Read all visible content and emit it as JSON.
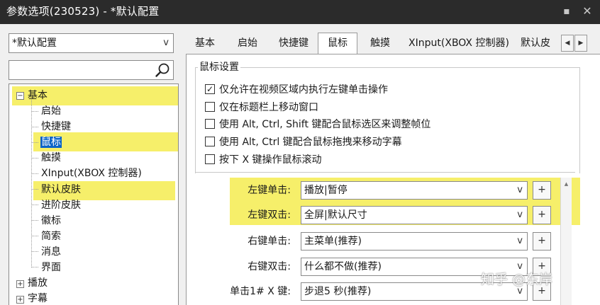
{
  "window": {
    "title": "参数选项(230523) - *默认配置"
  },
  "left": {
    "profile_value": "*默认配置",
    "profile_arrow": "v",
    "search_placeholder": "",
    "tree": {
      "basic": "基本",
      "children": [
        "启始",
        "快捷键",
        "鼠标",
        "触摸",
        "XInput(XBOX 控制器)",
        "默认皮肤",
        "进阶皮肤",
        "徽标",
        "简索",
        "消息",
        "界面"
      ],
      "play": "播放",
      "subtitle": "字幕",
      "expand_minus": "−",
      "expand_plus": "+"
    }
  },
  "tabs": [
    "基本",
    "启始",
    "快捷键",
    "鼠标",
    "触摸",
    "XInput(XBOX 控制器)",
    "默认皮"
  ],
  "tab_scroll": {
    "left": "◀",
    "right": "▶"
  },
  "mouse": {
    "group_title": "鼠标设置",
    "options": [
      {
        "label": "仅允许在视频区域内执行左键单击操作",
        "checked": true
      },
      {
        "label": "仅在标题栏上移动窗口",
        "checked": false
      },
      {
        "label": "使用 Alt, Ctrl, Shift 键配合鼠标选区来调整帧位",
        "checked": false
      },
      {
        "label": "使用 Alt, Ctrl 键配合鼠标拖拽来移动字幕",
        "checked": false
      },
      {
        "label": "按下 X 键操作鼠标滚动",
        "checked": false
      }
    ],
    "check_mark": "✓",
    "actions": [
      {
        "label": "左键单击:",
        "value": "播放|暂停"
      },
      {
        "label": "左键双击:",
        "value": "全屏|默认尺寸"
      },
      {
        "label": "右键单击:",
        "value": "主菜单(推荐)"
      },
      {
        "label": "右键双击:",
        "value": "什么都不做(推荐)"
      },
      {
        "label": "单击1# X 键:",
        "value": "步退5 秒(推荐)"
      }
    ],
    "select_arrow": "v",
    "plus_label": "+"
  },
  "colors": {
    "highlight": "#f6ef6a",
    "selection": "#0a64c8",
    "titlebar": "#2b2b2b"
  },
  "watermark": "知乎 @东岸"
}
